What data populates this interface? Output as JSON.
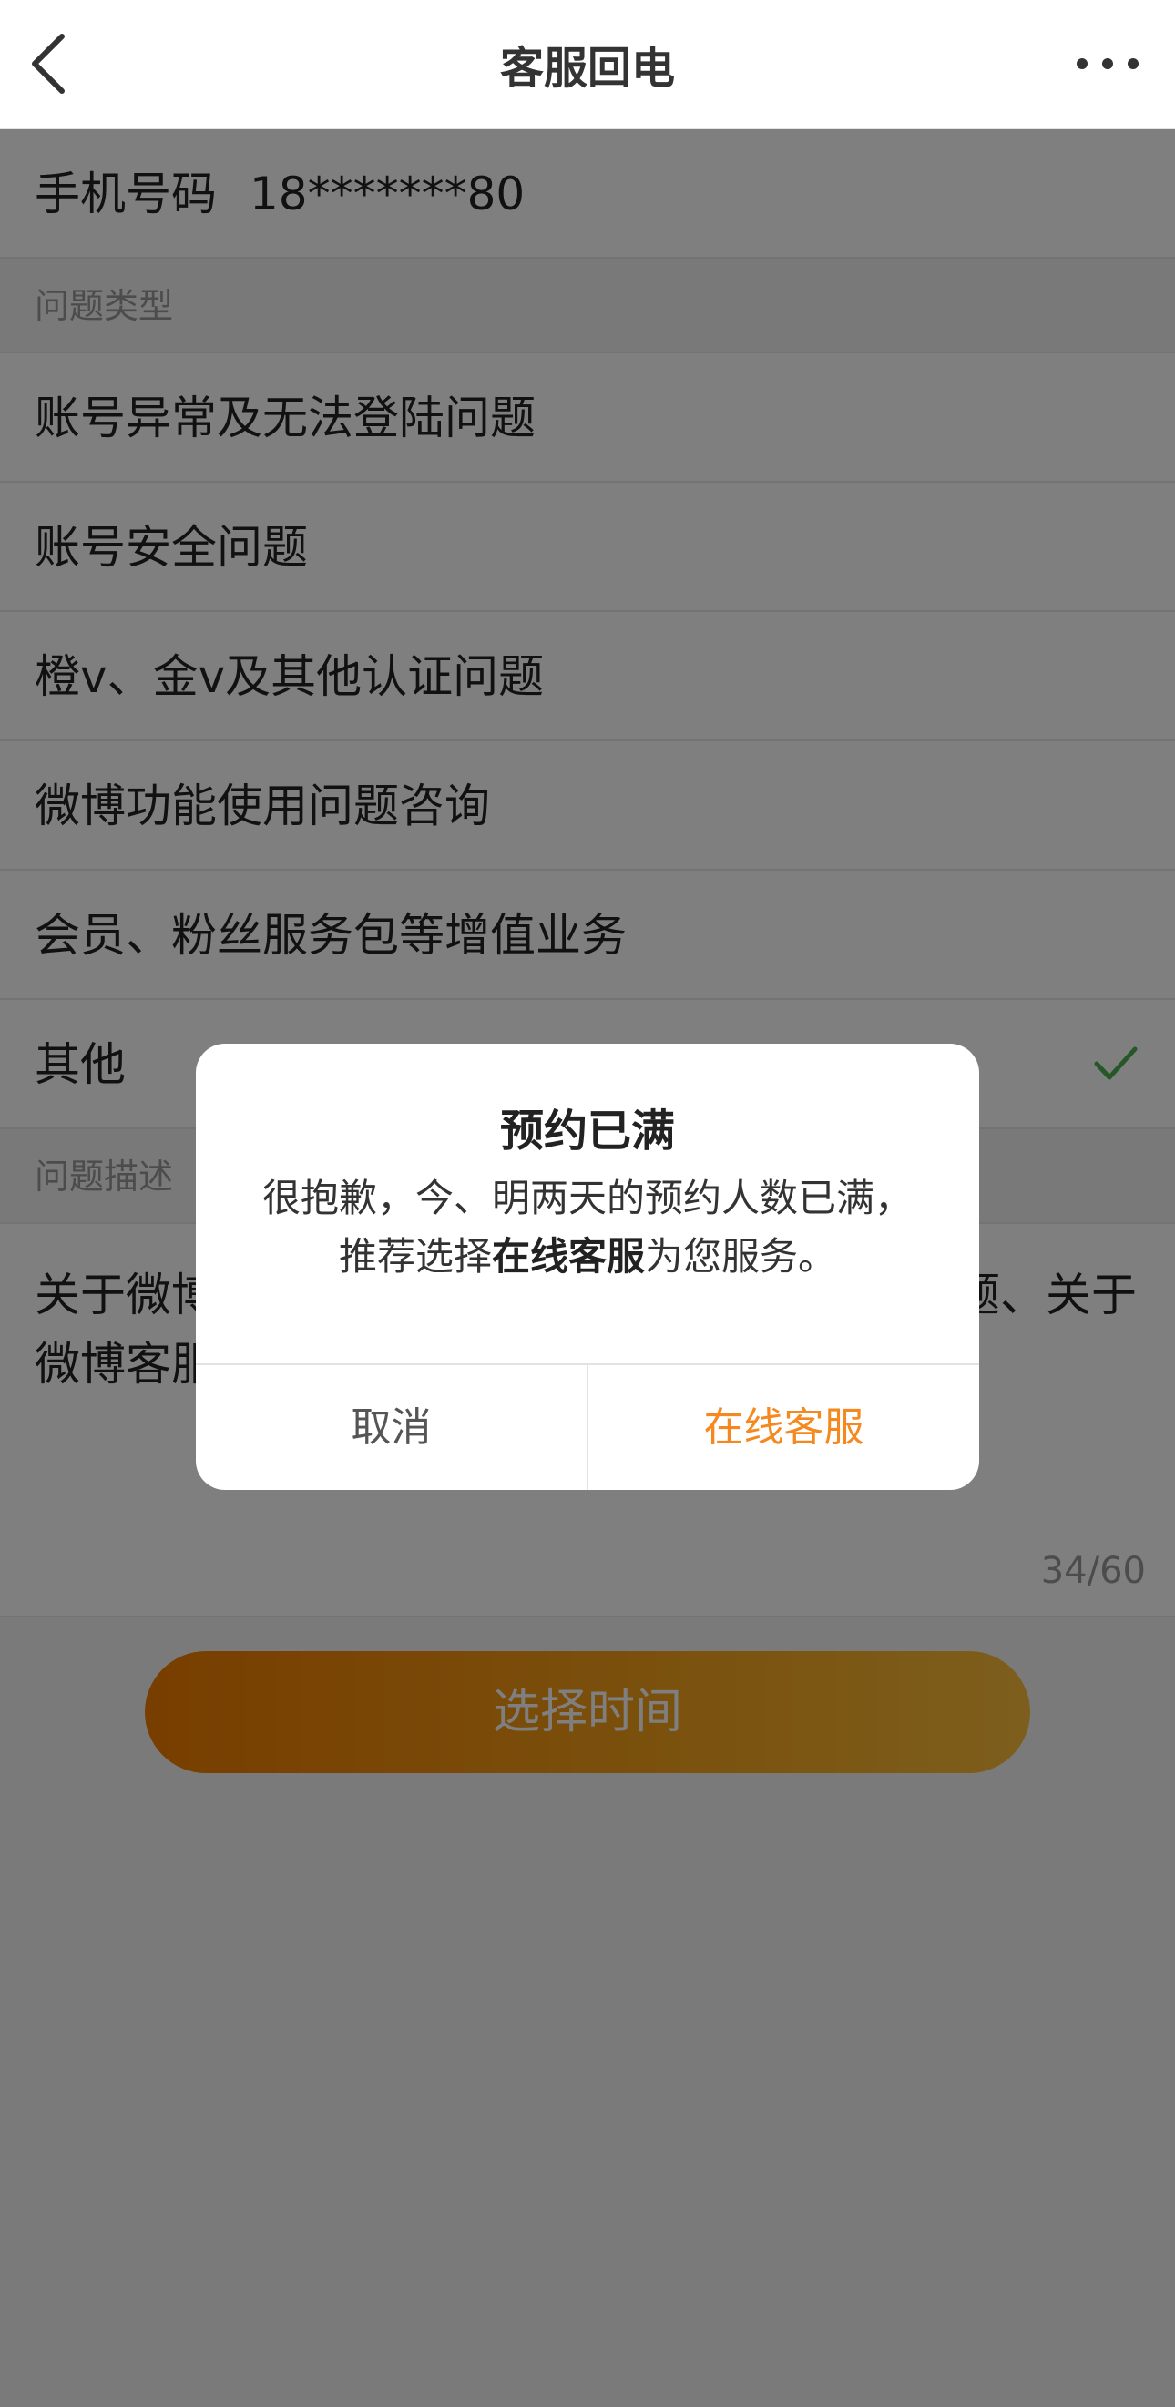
{
  "navbar": {
    "title": "客服回电",
    "back_icon": "chevron-left-icon",
    "more_icon": "more-dots-icon"
  },
  "phone": {
    "label": "手机号码",
    "value": "18*******80"
  },
  "problem_type": {
    "header": "问题类型",
    "options": [
      "账号异常及无法登陆问题",
      "账号安全问题",
      "橙v、金v及其他认证问题",
      "微博功能使用问题咨询",
      "会员、粉丝服务包等增值业务",
      "其他"
    ],
    "selected_index": 5,
    "check_color": "#4caf50"
  },
  "description": {
    "header": "问题描述",
    "text": "关于微博…………………………………………题、关于微博客服…………",
    "visible_left_line1": "关于微博",
    "visible_right_line1": "题、关于",
    "visible_left_line2": "微博客服",
    "count": "34/60"
  },
  "primary_button": {
    "label": "选择时间"
  },
  "dialog": {
    "title": "预约已满",
    "message_line1": "很抱歉，今、明两天的预约人数已满，",
    "message_line2_pre": "推荐选择",
    "message_line2_bold": "在线客服",
    "message_line2_post": "为您服务。",
    "cancel_label": "取消",
    "confirm_label": "在线客服",
    "accent_color": "#f5891f"
  }
}
